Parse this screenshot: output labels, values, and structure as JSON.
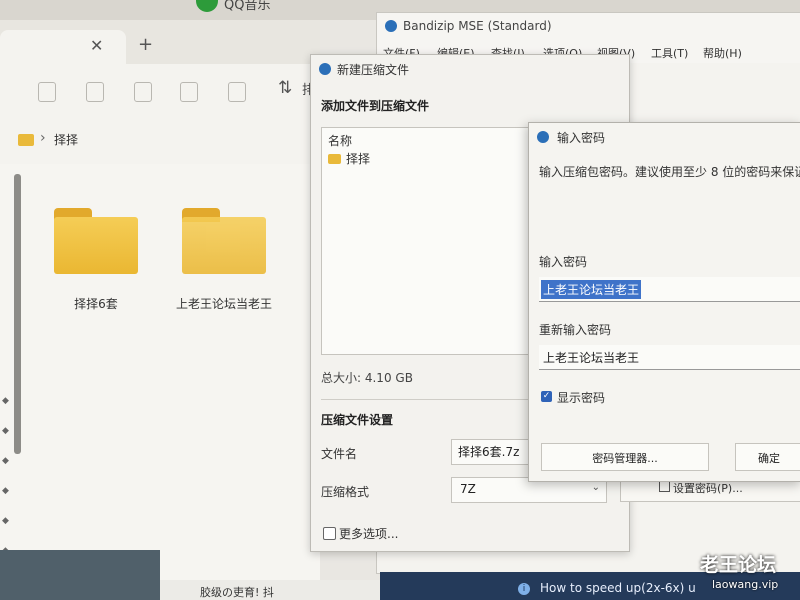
{
  "top_app": {
    "text": "QQ音乐"
  },
  "explorer": {
    "tab_close": "✕",
    "tab_new": "+",
    "sort_icon": "⇅",
    "sort_label": "排",
    "address": {
      "chevron": "›",
      "folder": "择择"
    },
    "items": [
      {
        "name": "择择6套"
      },
      {
        "name": "上老王论坛当老王"
      }
    ]
  },
  "bandizip": {
    "title": "Bandizip MSE (Standard)",
    "menu": [
      "文件(F)",
      "编辑(E)",
      "查找(I)",
      "选项(O)",
      "视图(V)",
      "工具(T)",
      "帮助(H)"
    ]
  },
  "new_archive": {
    "title": "新建压缩文件",
    "add_section": "添加文件到压缩文件",
    "column_name": "名称",
    "file_item": "择择",
    "total_size": "总大小: 4.10 GB",
    "settings_section": "压缩文件设置",
    "filename_label": "文件名",
    "filename_value": "择择6套.7z",
    "format_label": "压缩格式",
    "format_value": "7Z",
    "format_chevron": "⌄",
    "more_options": "更多选项...",
    "set_password_button": "设置密码(P)..."
  },
  "password_dialog": {
    "title": "输入密码",
    "description": "输入压缩包密码。建议使用至少 8 位的密码来保证",
    "enter_label": "输入密码",
    "enter_value": "上老王论坛当老王",
    "reenter_label": "重新输入密码",
    "reenter_value": "上老王论坛当老王",
    "show_password_label": "显示密码",
    "show_password_check": "✓",
    "password_manager_button": "密码管理器...",
    "ok_button": "确定"
  },
  "bottom": {
    "mid_text": "胶级の吏育! 抖",
    "info_icon": "i",
    "info_text": "How to speed up(2x-6x) u"
  },
  "watermark": {
    "cn": "老王论坛",
    "url": "laowang.vip"
  }
}
